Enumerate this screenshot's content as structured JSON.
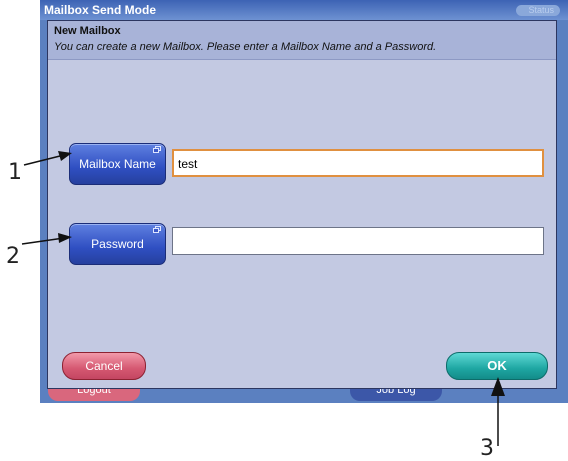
{
  "window": {
    "title": "Mailbox Send Mode",
    "status_ghost": "Status"
  },
  "background_buttons": {
    "logout_label": "Logout",
    "job_log_label": "Job Log"
  },
  "dialog": {
    "title": "New Mailbox",
    "instruction": "You can create a new Mailbox. Please enter a Mailbox Name and a Password.",
    "fields": [
      {
        "button_label": "Mailbox Name",
        "value": "test"
      },
      {
        "button_label": "Password",
        "value": ""
      }
    ],
    "cancel_label": "Cancel",
    "ok_label": "OK"
  },
  "callouts": [
    "1",
    "2",
    "3"
  ],
  "colors": {
    "screen_bg": "#5b80c0",
    "dialog_bg": "#c3c9e2",
    "field_button": "#2f4fc2",
    "cancel_button": "#d55871",
    "ok_button": "#1ea6a2",
    "active_input_border": "#e09040"
  },
  "icons": {
    "field_button_corner": "window-stack-icon"
  }
}
